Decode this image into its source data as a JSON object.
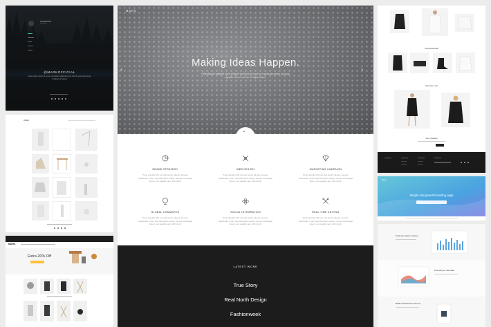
{
  "dark_panel": {
    "handle": "@MARKOFFICIAL",
    "caption": "Lorem ipsum dolor sit amet, consectetur adipiscing elit. Sed do eiusmod tempor incididunt ut labore"
  },
  "shop_panel": {
    "logo": "mars"
  },
  "store_panel": {
    "logo": "MARS",
    "promo": "Extra 20% Off"
  },
  "hero": {
    "logo": "MARS",
    "title": "Making Ideas Happen.",
    "subtitle": "Pellentesque habitant morbi tristique senectus et netus et malesuada fames ac turpis egestas. Donec vel nisl vel ligula luctus."
  },
  "features": [
    {
      "icon": "pie-chart-icon",
      "title": "BRAND STRATEGY",
      "text": "Proin gravida nibh vel velit auctor aliquet. Aenean sollicitudin, lorem quis bibendum auctor, nisi elit consequat ipsum, nec sagittis sem nibh id elit."
    },
    {
      "icon": "pencil-ruler-icon",
      "title": "WEB DESIGN",
      "text": "Proin gravida nibh vel velit auctor aliquet. Aenean sollicitudin, lorem quis bibendum auctor, nisi elit consequat ipsum, nec sagittis sem nibh id elit."
    },
    {
      "icon": "balloon-icon",
      "title": "MARKETING CAMPAIGN",
      "text": "Proin gravida nibh vel velit auctor aliquet. Aenean sollicitudin, lorem quis bibendum auctor, nisi elit consequat ipsum, nec sagittis sem nibh id elit."
    },
    {
      "icon": "globe-icon",
      "title": "GLOBAL COMMERCE",
      "text": "Proin gravida nibh vel velit auctor aliquet. Aenean sollicitudin, lorem quis bibendum auctor, nisi elit consequat ipsum, nec sagittis sem nibh id elit."
    },
    {
      "icon": "atom-icon",
      "title": "SOCIAL INTEGRATION",
      "text": "Proin gravida nibh vel velit auctor aliquet. Aenean sollicitudin, lorem quis bibendum auctor, nisi elit consequat ipsum, nec sagittis sem nibh id elit."
    },
    {
      "icon": "tools-icon",
      "title": "REAL TIME EDITING",
      "text": "Proin gravida nibh vel velit auctor aliquet. Aenean sollicitudin, lorem quis bibendum auctor, nisi elit consequat ipsum, nec sagittis sem nibh id elit."
    }
  ],
  "latest_work": {
    "title": "LATEST WORK",
    "items": [
      "True Story",
      "Real North Design",
      "Fashionweek"
    ]
  },
  "fashion_panel": {
    "section1": "Shop Essentials",
    "section2": "Shop the Look",
    "subscribe": "Stay Updated"
  },
  "landing_panel": {
    "logo": "Mars",
    "headline": "Simple and powerful landing page"
  },
  "cards_panel": {
    "card1": "Track your sales in real time",
    "card2": "Fill it with your own ideas",
    "card3": "Mobile optimized out of the box"
  },
  "colors": {
    "hero_gray": "#6c6e71",
    "dark": "#1c1c1c",
    "landing_blue": "#4aa3e0",
    "chart_blue": "#5aa6e0",
    "chart_red": "#e07a6a"
  }
}
